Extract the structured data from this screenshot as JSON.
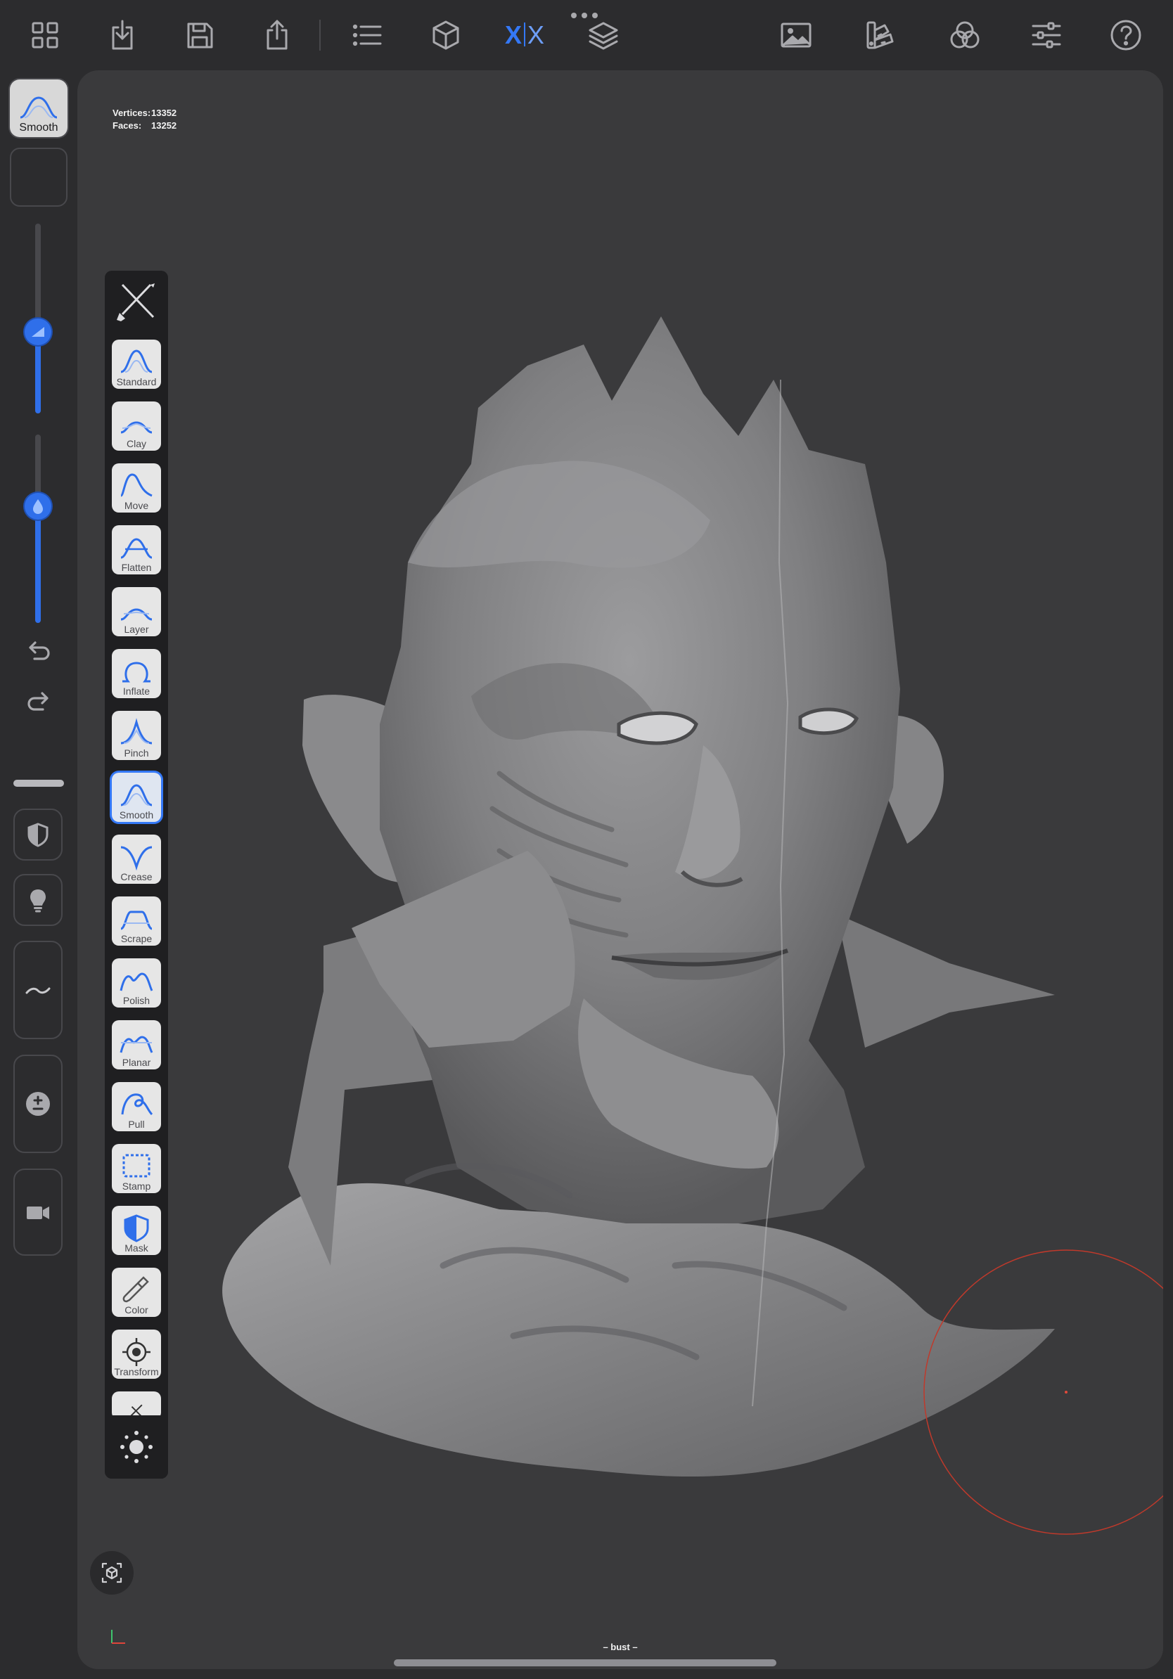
{
  "toolbar": {
    "left_icons": [
      "grid-icon",
      "import-icon",
      "save-icon",
      "share-icon",
      "scene-list-icon",
      "primitive-cube-icon",
      "symmetry-icon",
      "layers-icon"
    ],
    "symmetry": {
      "left": "X",
      "right": "X"
    },
    "right_icons": [
      "background-image-icon",
      "material-palette-icon",
      "color-channels-icon",
      "settings-sliders-icon",
      "help-icon"
    ]
  },
  "current_tool": {
    "label": "Smooth"
  },
  "sliders": {
    "radius": 0.43,
    "intensity": 0.62
  },
  "stats": {
    "vertices_label": "Vertices:",
    "vertices": "13352",
    "faces_label": "Faces:",
    "faces": "13252"
  },
  "tools": [
    {
      "label": "Standard",
      "icon": "standard-brush-icon"
    },
    {
      "label": "Clay",
      "icon": "clay-brush-icon"
    },
    {
      "label": "Move",
      "icon": "move-brush-icon"
    },
    {
      "label": "Flatten",
      "icon": "flatten-brush-icon"
    },
    {
      "label": "Layer",
      "icon": "layer-brush-icon"
    },
    {
      "label": "Inflate",
      "icon": "inflate-brush-icon"
    },
    {
      "label": "Pinch",
      "icon": "pinch-brush-icon"
    },
    {
      "label": "Smooth",
      "icon": "smooth-brush-icon",
      "active": true
    },
    {
      "label": "Crease",
      "icon": "crease-brush-icon"
    },
    {
      "label": "Scrape",
      "icon": "scrape-brush-icon"
    },
    {
      "label": "Polish",
      "icon": "polish-brush-icon"
    },
    {
      "label": "Planar",
      "icon": "planar-brush-icon"
    },
    {
      "label": "Pull",
      "icon": "pull-brush-icon"
    },
    {
      "label": "Stamp",
      "icon": "stamp-brush-icon"
    },
    {
      "label": "Mask",
      "icon": "mask-brush-icon"
    },
    {
      "label": "Color",
      "icon": "color-paint-icon"
    },
    {
      "label": "Transform",
      "icon": "transform-gizmo-icon"
    }
  ],
  "mesh_name": "– bust –",
  "colors": {
    "accent": "#3478f6",
    "background": "#2c2c2e",
    "viewport": "#3a3a3c",
    "cursor": "#c0392b"
  }
}
